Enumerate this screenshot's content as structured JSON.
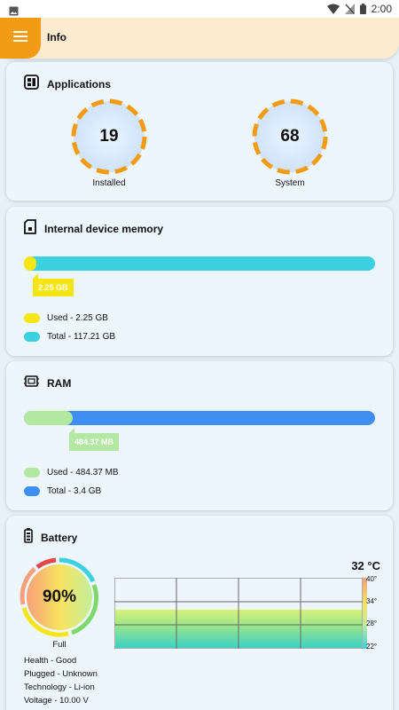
{
  "status_bar": {
    "time": "2:00"
  },
  "app_bar": {
    "title": "Info",
    "menu_icon": "hamburger-menu-icon"
  },
  "colors": {
    "accent": "#f39b12",
    "appbar_bg": "#fdebcf",
    "storage_used": "#f7e514",
    "storage_total": "#3cd1e0",
    "ram_used": "#b3e8a3",
    "ram_total": "#3f8ff2"
  },
  "applications": {
    "title": "Applications",
    "installed": {
      "value": "19",
      "label": "Installed"
    },
    "system": {
      "value": "68",
      "label": "System"
    }
  },
  "internal_memory": {
    "title": "Internal device memory",
    "used_fraction": 0.019,
    "tag": "2.25 GB",
    "legend_used": "Used - 2.25 GB",
    "legend_total": "Total - 117.21 GB"
  },
  "ram": {
    "title": "RAM",
    "used_fraction": 0.139,
    "tag": "484.37 MB",
    "legend_used": "Used - 484.37 MB",
    "legend_total": "Total - 3.4 GB"
  },
  "battery": {
    "title": "Battery",
    "percent_label": "90%",
    "percent": 90,
    "status": "Full",
    "health": "Health - Good",
    "plugged": "Plugged - Unknown",
    "technology": "Technology - Li-ion",
    "voltage": "Voltage - 10.00 V",
    "temperature": "32 °C",
    "temperature_value": 32,
    "scale_ticks": [
      "40°",
      "34°",
      "28°",
      "22°"
    ]
  }
}
